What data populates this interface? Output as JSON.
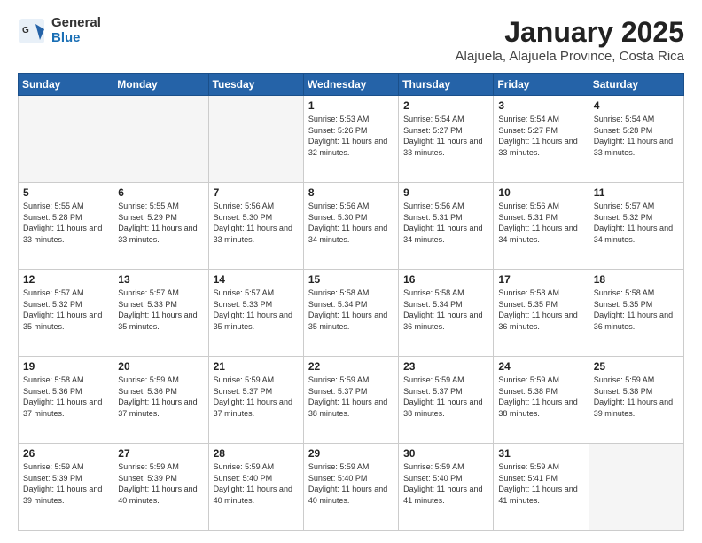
{
  "header": {
    "logo_general": "General",
    "logo_blue": "Blue",
    "title": "January 2025",
    "subtitle": "Alajuela, Alajuela Province, Costa Rica"
  },
  "days_of_week": [
    "Sunday",
    "Monday",
    "Tuesday",
    "Wednesday",
    "Thursday",
    "Friday",
    "Saturday"
  ],
  "weeks": [
    [
      {
        "day": "",
        "empty": true
      },
      {
        "day": "",
        "empty": true
      },
      {
        "day": "",
        "empty": true
      },
      {
        "day": "1",
        "sunrise": "5:53 AM",
        "sunset": "5:26 PM",
        "daylight": "11 hours and 32 minutes."
      },
      {
        "day": "2",
        "sunrise": "5:54 AM",
        "sunset": "5:27 PM",
        "daylight": "11 hours and 33 minutes."
      },
      {
        "day": "3",
        "sunrise": "5:54 AM",
        "sunset": "5:27 PM",
        "daylight": "11 hours and 33 minutes."
      },
      {
        "day": "4",
        "sunrise": "5:54 AM",
        "sunset": "5:28 PM",
        "daylight": "11 hours and 33 minutes."
      }
    ],
    [
      {
        "day": "5",
        "sunrise": "5:55 AM",
        "sunset": "5:28 PM",
        "daylight": "11 hours and 33 minutes."
      },
      {
        "day": "6",
        "sunrise": "5:55 AM",
        "sunset": "5:29 PM",
        "daylight": "11 hours and 33 minutes."
      },
      {
        "day": "7",
        "sunrise": "5:56 AM",
        "sunset": "5:30 PM",
        "daylight": "11 hours and 33 minutes."
      },
      {
        "day": "8",
        "sunrise": "5:56 AM",
        "sunset": "5:30 PM",
        "daylight": "11 hours and 34 minutes."
      },
      {
        "day": "9",
        "sunrise": "5:56 AM",
        "sunset": "5:31 PM",
        "daylight": "11 hours and 34 minutes."
      },
      {
        "day": "10",
        "sunrise": "5:56 AM",
        "sunset": "5:31 PM",
        "daylight": "11 hours and 34 minutes."
      },
      {
        "day": "11",
        "sunrise": "5:57 AM",
        "sunset": "5:32 PM",
        "daylight": "11 hours and 34 minutes."
      }
    ],
    [
      {
        "day": "12",
        "sunrise": "5:57 AM",
        "sunset": "5:32 PM",
        "daylight": "11 hours and 35 minutes."
      },
      {
        "day": "13",
        "sunrise": "5:57 AM",
        "sunset": "5:33 PM",
        "daylight": "11 hours and 35 minutes."
      },
      {
        "day": "14",
        "sunrise": "5:57 AM",
        "sunset": "5:33 PM",
        "daylight": "11 hours and 35 minutes."
      },
      {
        "day": "15",
        "sunrise": "5:58 AM",
        "sunset": "5:34 PM",
        "daylight": "11 hours and 35 minutes."
      },
      {
        "day": "16",
        "sunrise": "5:58 AM",
        "sunset": "5:34 PM",
        "daylight": "11 hours and 36 minutes."
      },
      {
        "day": "17",
        "sunrise": "5:58 AM",
        "sunset": "5:35 PM",
        "daylight": "11 hours and 36 minutes."
      },
      {
        "day": "18",
        "sunrise": "5:58 AM",
        "sunset": "5:35 PM",
        "daylight": "11 hours and 36 minutes."
      }
    ],
    [
      {
        "day": "19",
        "sunrise": "5:58 AM",
        "sunset": "5:36 PM",
        "daylight": "11 hours and 37 minutes."
      },
      {
        "day": "20",
        "sunrise": "5:59 AM",
        "sunset": "5:36 PM",
        "daylight": "11 hours and 37 minutes."
      },
      {
        "day": "21",
        "sunrise": "5:59 AM",
        "sunset": "5:37 PM",
        "daylight": "11 hours and 37 minutes."
      },
      {
        "day": "22",
        "sunrise": "5:59 AM",
        "sunset": "5:37 PM",
        "daylight": "11 hours and 38 minutes."
      },
      {
        "day": "23",
        "sunrise": "5:59 AM",
        "sunset": "5:37 PM",
        "daylight": "11 hours and 38 minutes."
      },
      {
        "day": "24",
        "sunrise": "5:59 AM",
        "sunset": "5:38 PM",
        "daylight": "11 hours and 38 minutes."
      },
      {
        "day": "25",
        "sunrise": "5:59 AM",
        "sunset": "5:38 PM",
        "daylight": "11 hours and 39 minutes."
      }
    ],
    [
      {
        "day": "26",
        "sunrise": "5:59 AM",
        "sunset": "5:39 PM",
        "daylight": "11 hours and 39 minutes."
      },
      {
        "day": "27",
        "sunrise": "5:59 AM",
        "sunset": "5:39 PM",
        "daylight": "11 hours and 40 minutes."
      },
      {
        "day": "28",
        "sunrise": "5:59 AM",
        "sunset": "5:40 PM",
        "daylight": "11 hours and 40 minutes."
      },
      {
        "day": "29",
        "sunrise": "5:59 AM",
        "sunset": "5:40 PM",
        "daylight": "11 hours and 40 minutes."
      },
      {
        "day": "30",
        "sunrise": "5:59 AM",
        "sunset": "5:40 PM",
        "daylight": "11 hours and 41 minutes."
      },
      {
        "day": "31",
        "sunrise": "5:59 AM",
        "sunset": "5:41 PM",
        "daylight": "11 hours and 41 minutes."
      },
      {
        "day": "",
        "empty": true
      }
    ]
  ]
}
